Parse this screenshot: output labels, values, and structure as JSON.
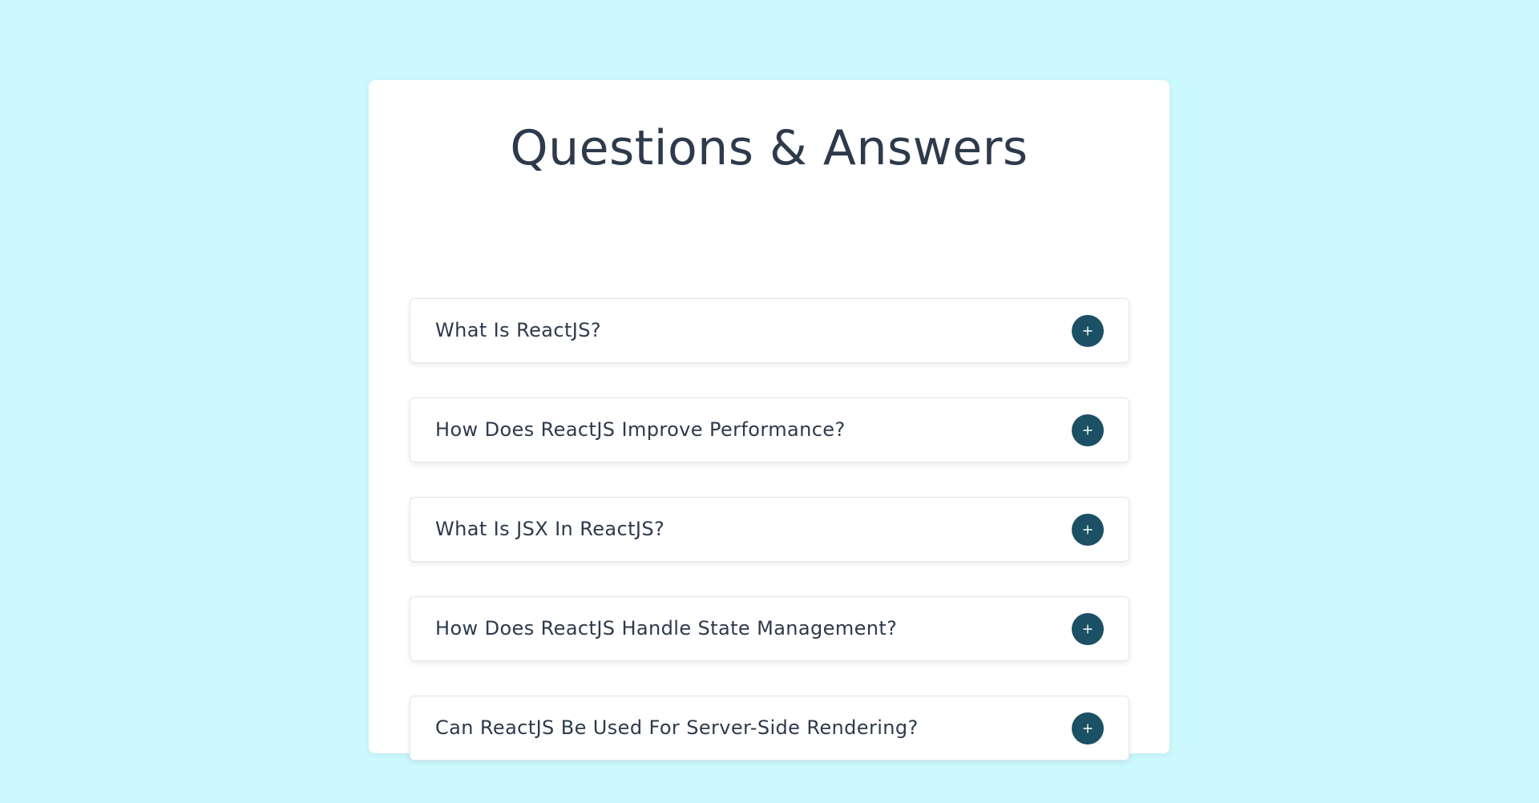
{
  "page": {
    "title": "Questions & Answers",
    "background_color": "#ccf9fe",
    "accent_color": "#1b5065",
    "text_color": "#2d3a4b"
  },
  "faq": {
    "items": [
      {
        "question": "What Is ReactJS?",
        "toggle_icon": "plus-icon"
      },
      {
        "question": "How Does ReactJS Improve Performance?",
        "toggle_icon": "plus-icon"
      },
      {
        "question": "What Is JSX In ReactJS?",
        "toggle_icon": "plus-icon"
      },
      {
        "question": "How Does ReactJS Handle State Management?",
        "toggle_icon": "plus-icon"
      },
      {
        "question": "Can ReactJS Be Used For Server-Side Rendering?",
        "toggle_icon": "plus-icon"
      }
    ]
  }
}
